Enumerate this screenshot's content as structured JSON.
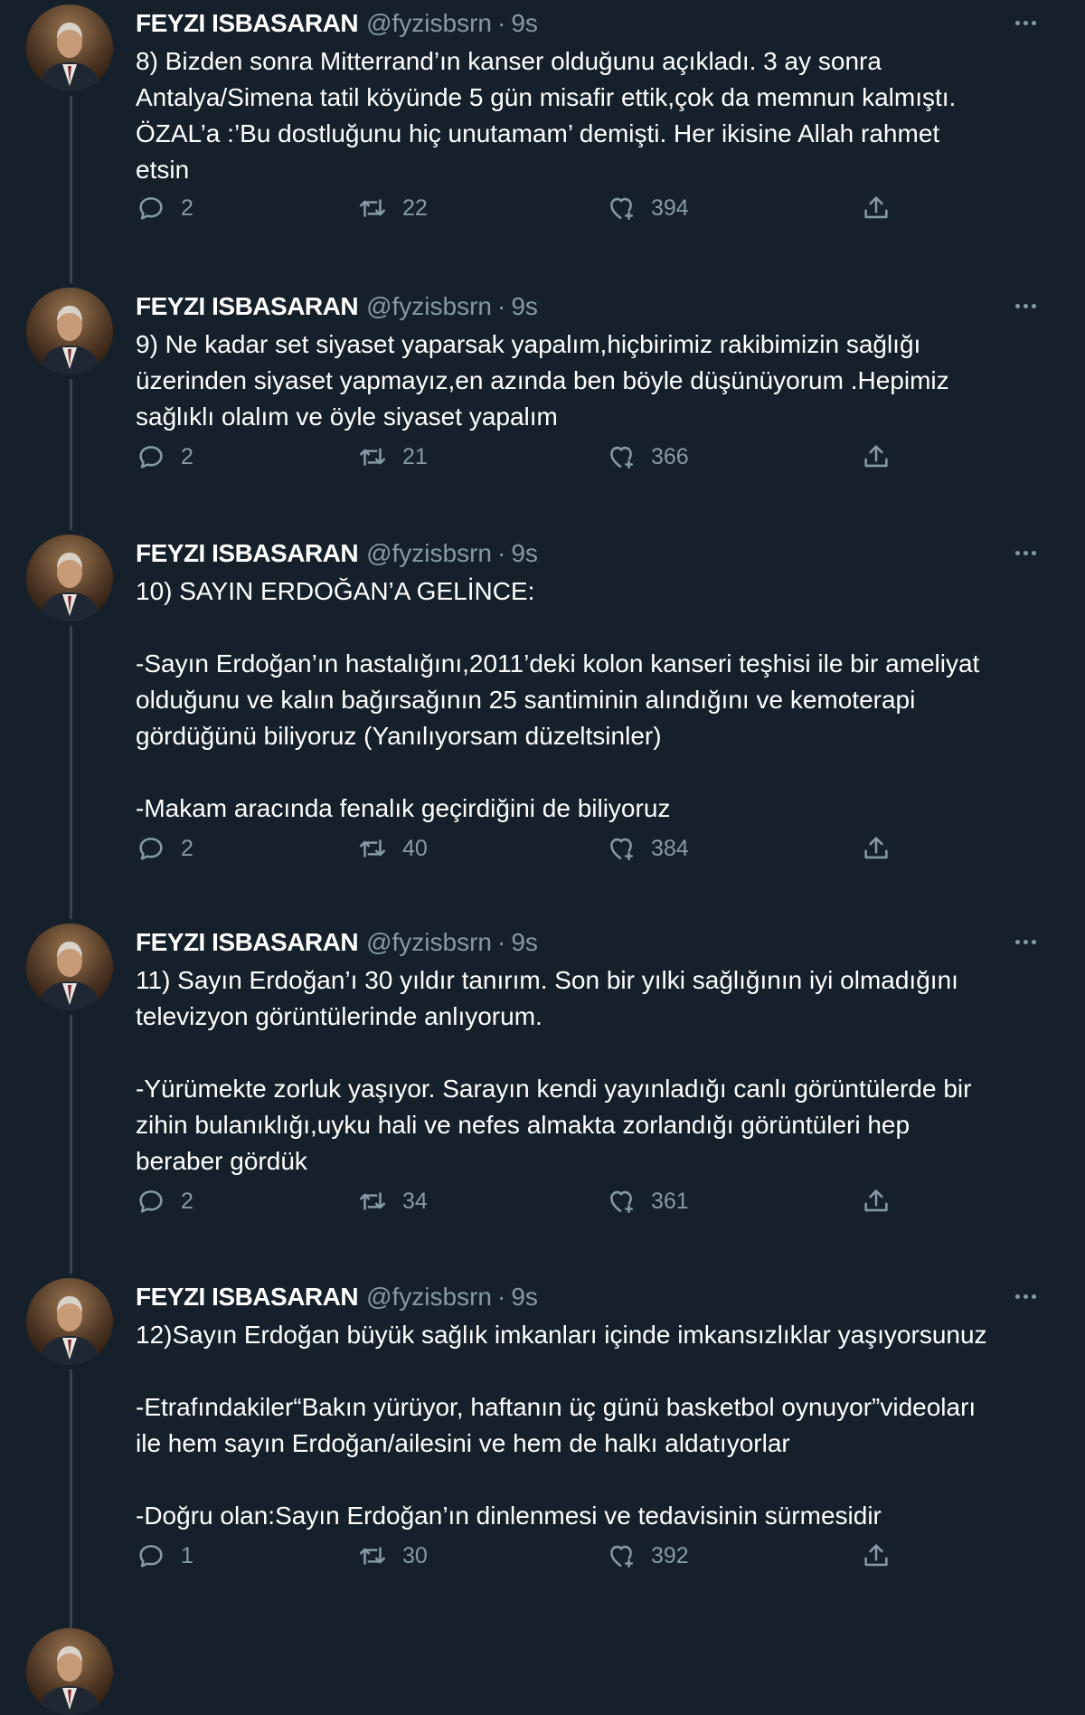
{
  "tweets": [
    {
      "name": "FEYZI ISBASARAN",
      "handle": "@fyzisbsrn",
      "separator": "·",
      "time": "9s",
      "lines": [
        "8) Bizden sonra Mitterrand’ın kanser olduğunu açıkladı. 3 ay sonra",
        "Antalya/Simena  tatil köyünde 5 gün misafir ettik,çok da memnun kalmıştı.",
        "ÖZAL’a :’Bu dostluğunu hiç unutamam’ demişti. Her ikisine Allah rahmet",
        "etsin"
      ],
      "replies": "2",
      "retweets": "22",
      "likes": "394"
    },
    {
      "name": "FEYZI ISBASARAN",
      "handle": "@fyzisbsrn",
      "separator": "·",
      "time": "9s",
      "lines": [
        "9) Ne kadar set siyaset yaparsak yapalım,hiçbirimiz rakibimizin sağlığı",
        "üzerinden siyaset yapmayız,en azında ben böyle düşünüyorum .Hepimiz",
        "sağlıklı olalım ve öyle siyaset yapalım"
      ],
      "replies": "2",
      "retweets": "21",
      "likes": "366"
    },
    {
      "name": "FEYZI ISBASARAN",
      "handle": "@fyzisbsrn",
      "separator": "·",
      "time": "9s",
      "lines": [
        "10) SAYIN ERDOĞAN’A GELİNCE:",
        "",
        "-Sayın Erdoğan’ın hastalığını,2011’deki kolon kanseri teşhisi ile bir ameliyat",
        "olduğunu ve kalın bağırsağının 25 santiminin alındığını ve kemoterapi",
        "gördüğünü biliyoruz (Yanılıyorsam düzeltsinler)",
        "",
        "-Makam aracında fenalık geçirdiğini de biliyoruz"
      ],
      "replies": "2",
      "retweets": "40",
      "likes": "384"
    },
    {
      "name": "FEYZI ISBASARAN",
      "handle": "@fyzisbsrn",
      "separator": "·",
      "time": "9s",
      "lines": [
        "11) Sayın Erdoğan’ı 30 yıldır tanırım. Son bir yılki sağlığının iyi olmadığını",
        "televizyon görüntülerinde anlıyorum.",
        "",
        "-Yürümekte zorluk yaşıyor. Sarayın kendi yayınladığı canlı görüntülerde bir",
        "zihin bulanıklığı,uyku hali ve nefes almakta zorlandığı görüntüleri hep",
        "beraber gördük"
      ],
      "replies": "2",
      "retweets": "34",
      "likes": "361"
    },
    {
      "name": "FEYZI ISBASARAN",
      "handle": "@fyzisbsrn",
      "separator": "·",
      "time": "9s",
      "lines": [
        "12)Sayın Erdoğan büyük sağlık imkanları içinde imkansızlıklar yaşıyorsunuz",
        "",
        "-Etrafındakiler“Bakın yürüyor, haftanın üç günü basketbol oynuyor”videoları",
        "ile hem sayın Erdoğan/ailesini ve hem de halkı aldatıyorlar",
        "",
        "-Doğru olan:Sayın Erdoğan’ın dinlenmesi ve tedavisinin sürmesidir"
      ],
      "replies": "1",
      "retweets": "30",
      "likes": "392"
    }
  ],
  "icons": {
    "reply": "reply-icon",
    "retweet": "retweet-icon",
    "like": "heart-icon",
    "share": "share-icon",
    "more": "more-icon"
  },
  "colors": {
    "background": "#15202b",
    "primary_text": "#ffffff",
    "secondary_text": "#8899a6",
    "thread_line": "#38444d"
  }
}
